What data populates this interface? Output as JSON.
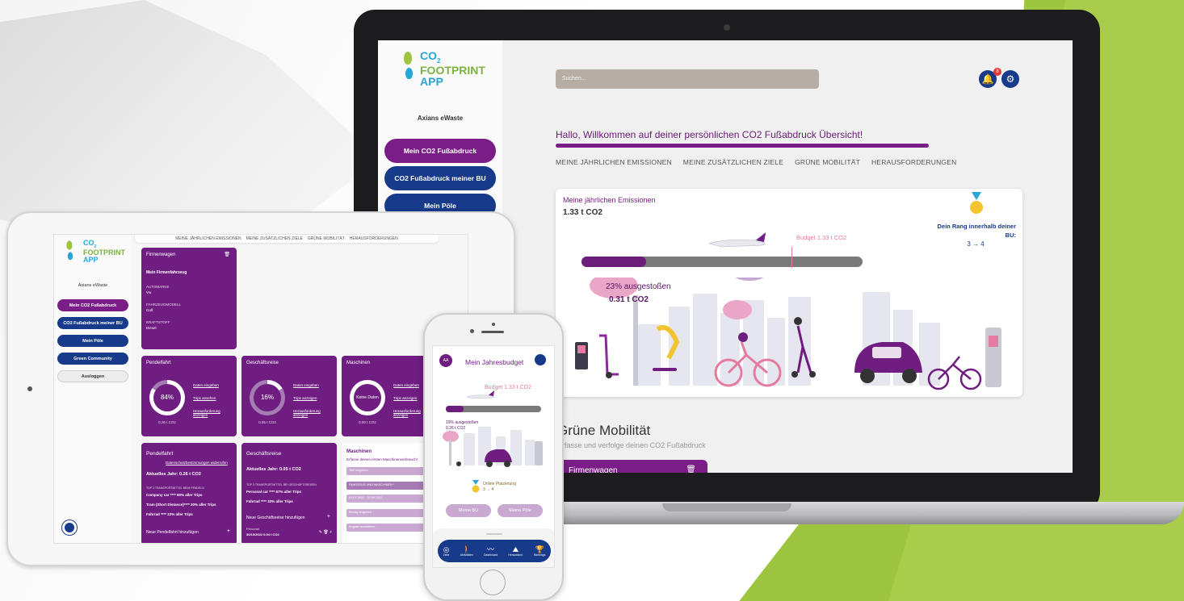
{
  "brand": {
    "line1": "CO",
    "sub": "2",
    "line2": "FOOTPRINT",
    "line3": "APP"
  },
  "colors": {
    "purple": "#7b1d86",
    "navy": "#173a8a",
    "green": "#9ec53f",
    "pink": "#e57ba0",
    "grey_track": "#7a7a7a"
  },
  "laptop": {
    "org": "Axians eWaste",
    "nav": [
      "Mein CO2 Fußabdruck",
      "CO2 Fußabdruck meiner BU",
      "Mein Pöle"
    ],
    "search_placeholder": "Suchen...",
    "notification_count": "8",
    "welcome": "Hallo, Willkommen auf deiner persönlichen CO2 Fußabdruck Übersicht!",
    "tabs": [
      "MEINE JÄHRLICHEN EMISSIONEN",
      "MEINE ZUSÄTZLICHEN ZIELE",
      "GRÜNE MOBILITÄT",
      "HERAUSFORDERUNGEN"
    ],
    "emissions": {
      "title": "Meine jährlichen Emissionen",
      "value": "1.33 t CO2",
      "budget": "Budget 1.33 t CO2",
      "progress": 0.23,
      "pct_label": "23% ausgestoßen",
      "co2_label": "0.31 t CO2",
      "rank_title": "Dein Rang innerhalb deiner BU:",
      "rank_from": "3",
      "rank_to": "4"
    },
    "green_mobility": {
      "title": "Grüne Mobilität",
      "subtitle": "Erfasse und verfolge deinen CO2 Fußabdruck",
      "card": "Firmenwagen"
    }
  },
  "tablet": {
    "org": "Axians eWaste",
    "nav": [
      "Mein CO2 Fußabdruck",
      "CO2 Fußabdruck meiner BU",
      "Mein Pöle",
      "Green Community",
      "Ausloggen"
    ],
    "tabs": [
      "MEINE JÄHRLICHEN EMISSIONEN",
      "MEINE ZUSÄTZLICHEN ZIELE",
      "GRÜNE MOBILITÄT",
      "HERAUSFORDERUNGEN"
    ],
    "firmenwagen": {
      "title": "Firmenwagen",
      "subtitle": "Mein Firmenfahrzeug",
      "fields": [
        {
          "label": "AUTOMARKE",
          "value": "Vw"
        },
        {
          "label": "FAHRZEUGMODELL",
          "value": "Golf"
        },
        {
          "label": "KRAFTSTOFF",
          "value": "Diesel"
        }
      ]
    },
    "summary_cards": [
      {
        "title": "Pendelfahrt",
        "ring": "84%",
        "progress": 0.84,
        "co2": "0.26 t CO2",
        "links": [
          "Daten eingeben",
          "Trips ansehen",
          "Herausforderung anzeigen"
        ]
      },
      {
        "title": "Geschäftsreise",
        "ring": "16%",
        "progress": 0.16,
        "co2": "0.05 t CO2",
        "links": [
          "Daten eingeben",
          "Trips anzeigen",
          "Herausforderung anzeigen"
        ]
      },
      {
        "title": "Maschinen",
        "ring": "Keine Daten",
        "progress": 0,
        "co2": "0.00 t CO2",
        "links": [
          "Daten eingeben",
          "Trips anzeigen",
          "Herausforderung anzeigen"
        ]
      }
    ],
    "pendelfahrt": {
      "title": "Pendelfahrt",
      "link": "Datenschutzbestimmungen widerrufen",
      "current": "Aktuelles Jahr: 0.26 t CO2",
      "top": "TOP 3 TRANSPORTMITTEL BEIM PENDELN",
      "rows": [
        "Company car **** 60% aller Trips",
        "Tram (Short Distance)**** 20% aller Trips",
        "Fahrrad **** 22% aller Trips"
      ],
      "add": "Neue Pendelfahrt hinzufügen"
    },
    "geschaeftsreise": {
      "title": "Geschäftsreise",
      "current": "Aktuelles Jahr: 0.05 t CO2",
      "top": "TOP 3 TRANSPORTMITTEL BEI GESCHÄFTSREISEN",
      "rows": [
        "Personal car **** 67% aller Trips",
        "Fahrrad **** 33% aller Trips"
      ],
      "add": "Neue Geschäftsreise hinzufügen",
      "entry_label": "Personal",
      "entry": "30/10/2022   0.04 t CO2"
    },
    "maschinen": {
      "title": "Maschinen",
      "subtitle": "Erfasse deinen ersten Maschinenverbrauch!",
      "fields": [
        "Titel eingeben",
        "FAHRZEUG UND MASCHINEN *",
        "01.07.2022 - 30.09.2022",
        "Betrag eingeben",
        "Angabe auswählen"
      ]
    }
  },
  "phone": {
    "avatar": "AA",
    "title": "Mein Jahresbudget",
    "budget": "Budget 1.33 t CO2",
    "progress": 0.19,
    "pct_label": "19% ausgestoßen",
    "co2_label": "0.26 t CO2",
    "rank_label": "Online Platzierung",
    "rank": "3 → 4",
    "buttons": [
      "Meine BU",
      "Meine Pöle"
    ],
    "nav": [
      {
        "icon": "target-icon",
        "glyph": "◎",
        "label": "Ziele"
      },
      {
        "icon": "walk-icon",
        "glyph": "🚶",
        "label": "Aktivitäten"
      },
      {
        "icon": "dashboard-icon",
        "glyph": "〰",
        "label": "Dashboard"
      },
      {
        "icon": "challenge-icon",
        "glyph": "⛰",
        "label": "Herausford."
      },
      {
        "icon": "trophy-icon",
        "glyph": "🏆",
        "label": "Rankings"
      }
    ]
  }
}
